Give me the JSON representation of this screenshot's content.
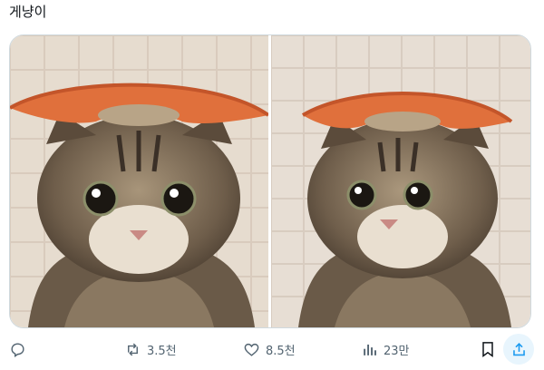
{
  "post": {
    "text": "게냥이"
  },
  "media": {
    "images": [
      {
        "description_icon": "cat-photo"
      },
      {
        "description_icon": "cat-photo"
      }
    ]
  },
  "actions": {
    "reply": {
      "icon": "reply-icon"
    },
    "repost": {
      "icon": "repost-icon",
      "count": "3.5천"
    },
    "like": {
      "icon": "heart-icon",
      "count": "8.5천"
    },
    "views": {
      "icon": "bar-chart-icon",
      "count": "23만"
    },
    "bookmark": {
      "icon": "bookmark-icon"
    },
    "share": {
      "icon": "share-icon"
    }
  },
  "colors": {
    "icon_gray": "#536471",
    "share_bg": "#e8f5fd",
    "share_fg": "#1d9bf0"
  }
}
